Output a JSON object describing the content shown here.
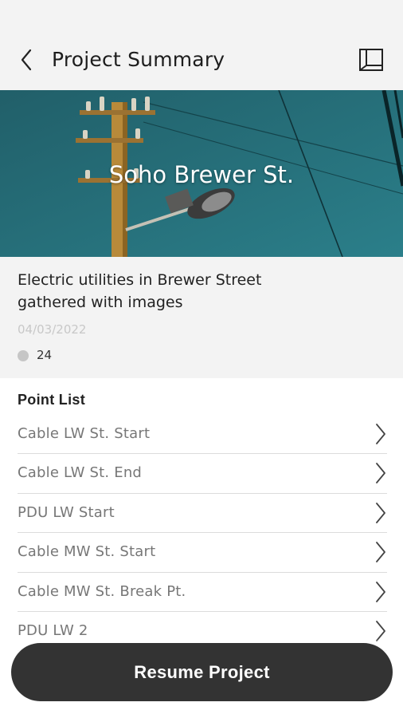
{
  "header": {
    "title": "Project Summary",
    "back_icon": "chevron-left-icon",
    "map_icon": "map-icon"
  },
  "project": {
    "name": "Soho Brewer St.",
    "description": "Electric utilities in Brewer Street gathered with images",
    "date": "04/03/2022",
    "point_count": "24"
  },
  "point_list": {
    "heading": "Point List",
    "items": [
      {
        "label": "Cable LW St. Start"
      },
      {
        "label": "Cable LW St. End"
      },
      {
        "label": "PDU LW Start"
      },
      {
        "label": "Cable MW St. Start"
      },
      {
        "label": "Cable MW St. Break Pt."
      },
      {
        "label": "PDU LW 2"
      }
    ]
  },
  "actions": {
    "resume_label": "Resume Project"
  },
  "colors": {
    "sky": "#1f6c78",
    "button": "#333333",
    "header_bg": "#f3f3f3"
  }
}
